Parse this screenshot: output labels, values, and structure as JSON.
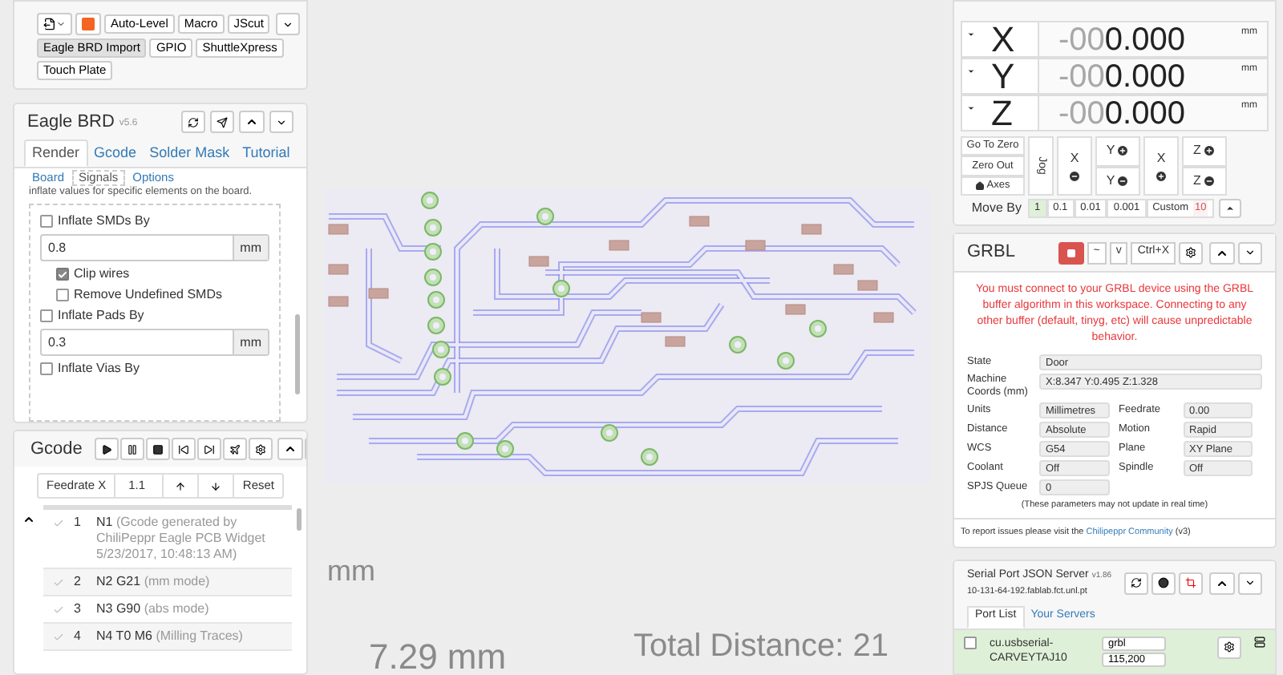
{
  "toolbar": {
    "buttons": [
      {
        "label": "Auto-Level",
        "selected": false
      },
      {
        "label": "Macro",
        "selected": false
      },
      {
        "label": "JScut",
        "selected": false
      },
      {
        "label": "Eagle BRD Import",
        "selected": true
      },
      {
        "label": "GPIO",
        "selected": false
      },
      {
        "label": "ShuttleXpress",
        "selected": false
      },
      {
        "label": "Touch Plate",
        "selected": false
      }
    ]
  },
  "eagle": {
    "title": "Eagle BRD",
    "version": "v5.6",
    "tabs": [
      {
        "label": "Render",
        "selected": true
      },
      {
        "label": "Gcode",
        "selected": false
      },
      {
        "label": "Solder Mask",
        "selected": false
      },
      {
        "label": "Tutorial",
        "selected": false
      }
    ],
    "subtabs": [
      {
        "label": "Board",
        "selected": false
      },
      {
        "label": "Signals",
        "selected": true
      },
      {
        "label": "Options",
        "selected": false
      }
    ],
    "intro": "inflate values for specific elements on the board.",
    "options": [
      {
        "kind": "check",
        "label": "Inflate SMDs By",
        "checked": false
      },
      {
        "kind": "field",
        "value": "0.8",
        "unit": "mm"
      },
      {
        "kind": "subcheck",
        "label": "Clip wires",
        "checked": true
      },
      {
        "kind": "subcheck",
        "label": "Remove Undefined SMDs",
        "checked": false
      },
      {
        "kind": "check",
        "label": "Inflate Pads By",
        "checked": false
      },
      {
        "kind": "field",
        "value": "0.3",
        "unit": "mm"
      },
      {
        "kind": "check",
        "label": "Inflate Vias By",
        "checked": false
      }
    ]
  },
  "gcode": {
    "title": "Gcode",
    "feedrate_label": "Feedrate X",
    "feedrate_value": "1.1",
    "reset": "Reset",
    "lines": [
      {
        "num": "1",
        "code": "N1",
        "comment": "(Gcode generated by ChiliPeppr Eagle PCB Widget 5/23/2017, 10:48:13 AM)"
      },
      {
        "num": "2",
        "code": "N2 G21",
        "comment": "(mm mode)"
      },
      {
        "num": "3",
        "code": "N3 G90",
        "comment": "(abs mode)"
      },
      {
        "num": "4",
        "code": "N4 T0 M6",
        "comment": "(Milling Traces)"
      }
    ]
  },
  "viewer": {
    "labels": [
      "mm",
      "7.29 mm",
      "Total Distance: 21"
    ]
  },
  "axes": {
    "rows": [
      {
        "axis": "X",
        "ghost": "-00",
        "value": "0.000",
        "unit": "mm"
      },
      {
        "axis": "Y",
        "ghost": "-00",
        "value": "0.000",
        "unit": "mm"
      },
      {
        "axis": "Z",
        "ghost": "-00",
        "value": "0.000",
        "unit": "mm"
      }
    ],
    "zero_buttons": [
      "Go To Zero",
      "Zero Out",
      "Axes"
    ],
    "jog_label": "Jog",
    "jog": [
      {
        "axis": "X",
        "kind": "minus"
      },
      {
        "axis": "Y",
        "kind": "plus"
      },
      {
        "axis": "Y",
        "kind": "minus"
      },
      {
        "axis": "X",
        "kind": "plus"
      },
      {
        "axis": "Z",
        "kind": "plus"
      },
      {
        "axis": "Z",
        "kind": "minus"
      }
    ],
    "move_by_label": "Move By",
    "move_by": [
      {
        "label": "1",
        "selected": true
      },
      {
        "label": "0.1",
        "selected": false
      },
      {
        "label": "0.01",
        "selected": false
      },
      {
        "label": "0.001",
        "selected": false
      }
    ],
    "custom_label": "Custom",
    "custom_value": "10"
  },
  "grbl": {
    "title": "GRBL",
    "buttons": [
      "~",
      "v",
      "Ctrl+X"
    ],
    "warning": "You must connect to your GRBL device using the GRBL buffer algorithm in this workspace. Connecting to any other buffer (default, tinyg, etc) will cause unpredictable behavior.",
    "state_label": "State",
    "state": "Door",
    "coords_label": "Machine Coords (mm)",
    "coords": "X:8.347 Y:0.495 Z:1.328",
    "fields": [
      {
        "label": "Units",
        "value": "Millimetres"
      },
      {
        "label": "Feedrate",
        "value": "0.00"
      },
      {
        "label": "Distance",
        "value": "Absolute"
      },
      {
        "label": "Motion",
        "value": "Rapid"
      },
      {
        "label": "WCS",
        "value": "G54"
      },
      {
        "label": "Plane",
        "value": "XY Plane"
      },
      {
        "label": "Coolant",
        "value": "Off"
      },
      {
        "label": "Spindle",
        "value": "Off"
      }
    ],
    "queue_label": "SPJS Queue",
    "queue": "0",
    "note": "(These parameters may not update in real time)",
    "footer": "To report issues please visit the",
    "footer_link": "Chilipeppr Community",
    "footer_end": "(v3)"
  },
  "serial": {
    "title": "Serial Port JSON Server",
    "version": "v1.86",
    "host": "10-131-64-192.fablab.fct.unl.pt",
    "tabs": [
      {
        "label": "Port List",
        "selected": true
      },
      {
        "label": "Your Servers",
        "selected": false
      }
    ],
    "ports": [
      {
        "name": "cu.usbserial-CARVEYTAJ10",
        "buffer": "grbl",
        "baud": "115,200",
        "checked": false,
        "connected": true
      }
    ]
  }
}
